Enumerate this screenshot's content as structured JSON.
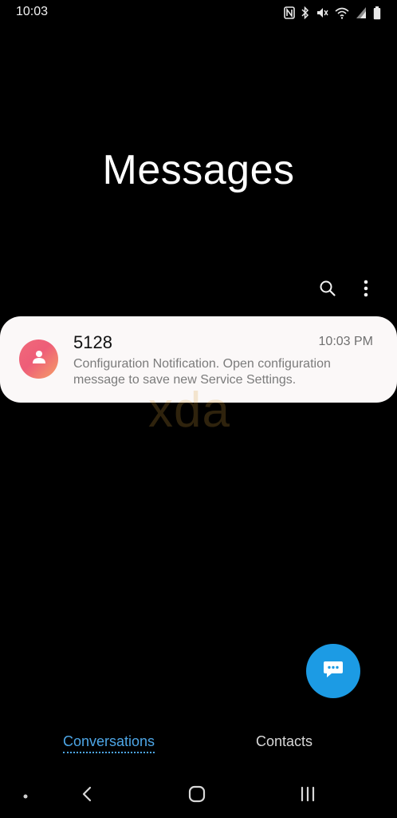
{
  "status_bar": {
    "time": "10:03",
    "icons": [
      "nfc-icon",
      "bluetooth-icon",
      "mute-icon",
      "wifi-icon",
      "signal-icon",
      "battery-icon"
    ]
  },
  "app": {
    "title": "Messages"
  },
  "toolbar": {
    "icons": [
      "search-icon",
      "more-options-icon"
    ]
  },
  "conversations": [
    {
      "name": "5128",
      "time": "10:03 PM",
      "preview": "Configuration Notification. Open configuration message to save new Service Settings.",
      "avatar_icon": "person-icon"
    }
  ],
  "watermark": "xda",
  "fab": {
    "icon": "compose-message-icon",
    "color": "#1c9be4"
  },
  "bottom_tabs": {
    "conversations_label": "Conversations",
    "contacts_label": "Contacts",
    "active": "Conversations",
    "accent_color": "#4da6e6"
  },
  "nav_bar": {
    "icons": [
      "dot-icon",
      "back-icon",
      "home-icon",
      "recents-icon"
    ]
  }
}
